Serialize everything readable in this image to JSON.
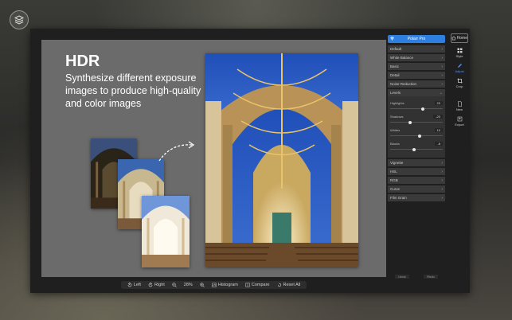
{
  "canvas": {
    "title": "HDR",
    "description": "Synthesize different exposure images to produce high-quality and color images"
  },
  "panel": {
    "pro_button": "Polarr Pro",
    "sections_top": [
      "Default",
      "White Balance",
      "Basic",
      "Detail",
      "Noise Reduction",
      "Levels"
    ],
    "levels": [
      {
        "label": "Highlights",
        "value": "20",
        "level": 0.62
      },
      {
        "label": "Shadows",
        "value": "-20",
        "level": 0.38
      },
      {
        "label": "Whites",
        "value": "10",
        "level": 0.56
      },
      {
        "label": "Blacks",
        "value": "-8",
        "level": 0.46
      }
    ],
    "sections_bottom": [
      "Vignette",
      "HSL",
      "RGB",
      "Curve",
      "Film Grain"
    ],
    "undo": "Undo",
    "redo": "Redo"
  },
  "rail": {
    "home": "Home",
    "tools": [
      "Style",
      "Adjust",
      "Crop",
      "New",
      "Export"
    ],
    "active_tool": "Adjust"
  },
  "toolbar": {
    "left": "Left",
    "right": "Right",
    "zoom": "28%",
    "histogram": "Histogram",
    "compare": "Compare",
    "reset": "Reset All"
  },
  "colors": {
    "accent": "#2f7fe0",
    "active_tool": "#4a96ff",
    "canvas": "#6b6b6b"
  }
}
